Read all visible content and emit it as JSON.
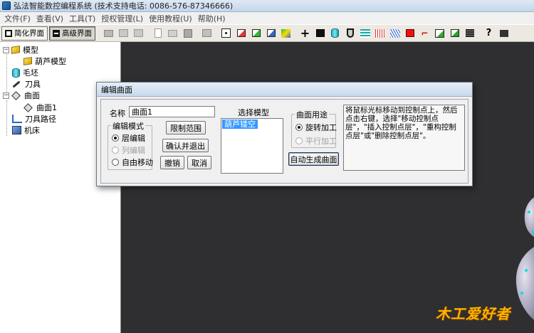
{
  "window": {
    "title": "弘法智能数控编程系统 (技术支持电话: 0086-576-87346666)"
  },
  "menu": [
    "文件(F)",
    "查看(V)",
    "工具(T)",
    "授权管理(L)",
    "使用教程(U)",
    "帮助(H)"
  ],
  "toolbar": {
    "simple_mode": "简化界面",
    "advanced_mode": "高级界面"
  },
  "tree": {
    "model": "模型",
    "model_child": "葫芦模型",
    "blank": "毛坯",
    "tool": "刀具",
    "surface": "曲面",
    "surface_child": "曲面1",
    "toolpath": "刀具路径",
    "machine": "机床"
  },
  "dialog": {
    "title": "编辑曲面",
    "name_label": "名称",
    "name_value": "曲面1",
    "edit_mode_title": "编辑模式",
    "mode_layer": "层编辑",
    "mode_column": "列编辑",
    "mode_free": "自由移动",
    "btn_limit": "限制范围",
    "btn_confirm_exit": "确认并退出",
    "btn_undo": "撤销",
    "btn_cancel": "取消",
    "select_model_label": "选择模型",
    "model_list": [
      "葫芦镂空"
    ],
    "usage_title": "曲面用途",
    "usage_rotate": "旋转加工",
    "usage_parallel": "平行加工",
    "btn_auto_generate": "自动生成曲面",
    "help_text": "将鼠标光标移动到控制点上，然后点击右键，选择\"移动控制点层\"，\"插入控制点层\"，\"重构控制点层\"或\"删除控制点层\"。"
  },
  "watermark": "木工爱好者"
}
